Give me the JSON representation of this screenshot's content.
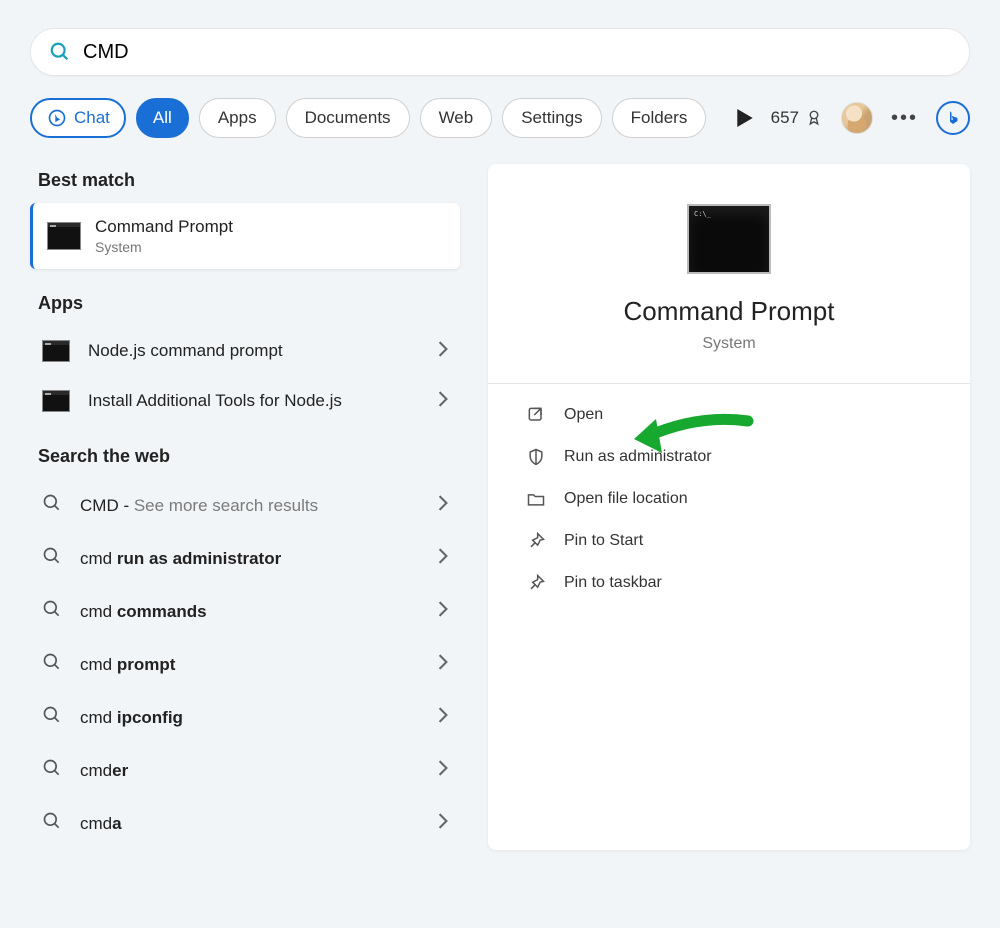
{
  "search": {
    "value": "CMD",
    "placeholder": ""
  },
  "filters": {
    "chat": "Chat",
    "all": "All",
    "apps": "Apps",
    "documents": "Documents",
    "web": "Web",
    "settings": "Settings",
    "folders": "Folders"
  },
  "points_count": "657",
  "sections": {
    "best_match": "Best match",
    "apps": "Apps",
    "search_web": "Search the web"
  },
  "best_match": {
    "title": "Command Prompt",
    "subtitle": "System"
  },
  "app_items": [
    {
      "label": "Node.js command prompt"
    },
    {
      "label": "Install Additional Tools for Node.js"
    }
  ],
  "web_items": [
    {
      "prefix": "CMD",
      "bold": "",
      "suffix": " - ",
      "muted": "See more search results"
    },
    {
      "prefix": "cmd ",
      "bold": "run as administrator",
      "suffix": "",
      "muted": ""
    },
    {
      "prefix": "cmd ",
      "bold": "commands",
      "suffix": "",
      "muted": ""
    },
    {
      "prefix": "cmd ",
      "bold": "prompt",
      "suffix": "",
      "muted": ""
    },
    {
      "prefix": "cmd ",
      "bold": "ipconfig",
      "suffix": "",
      "muted": ""
    },
    {
      "prefix": "cmd",
      "bold": "er",
      "suffix": "",
      "muted": ""
    },
    {
      "prefix": "cmd",
      "bold": "a",
      "suffix": "",
      "muted": ""
    }
  ],
  "panel": {
    "title": "Command Prompt",
    "subtitle": "System",
    "actions": {
      "open": "Open",
      "run_admin": "Run as administrator",
      "open_location": "Open file location",
      "pin_start": "Pin to Start",
      "pin_taskbar": "Pin to taskbar"
    }
  }
}
